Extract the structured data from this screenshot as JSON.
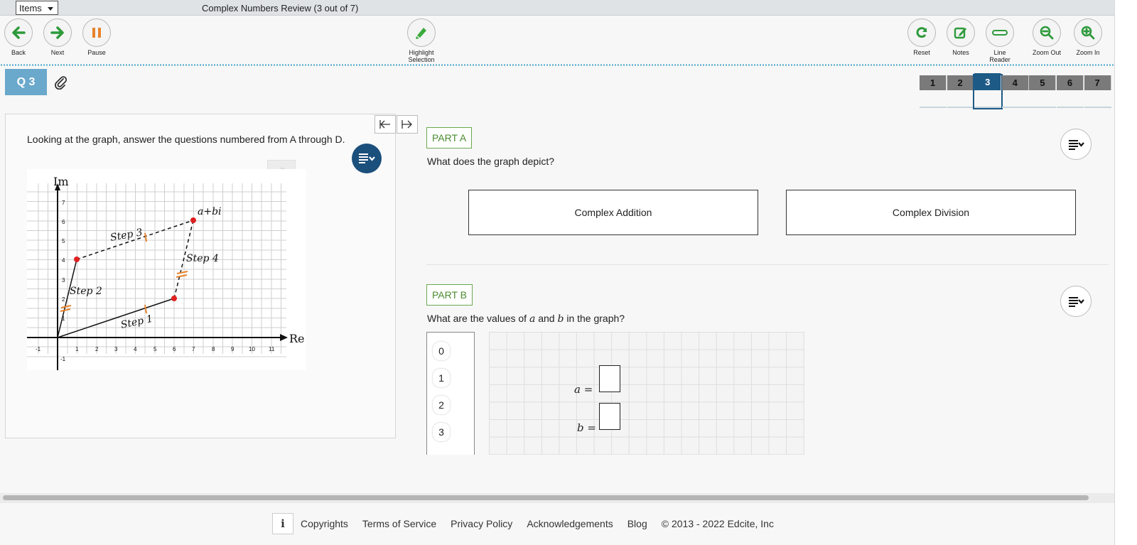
{
  "topbar": {
    "items_label": "Items",
    "title": "Complex Numbers Review (3 out of 7)"
  },
  "toolbar": {
    "back": "Back",
    "next": "Next",
    "pause": "Pause",
    "highlight": "Highlight Selection",
    "reset": "Reset",
    "notes": "Notes",
    "line_reader": "Line Reader",
    "zoom_out": "Zoom Out",
    "zoom_in": "Zoom In"
  },
  "question": {
    "badge": "Q 3",
    "nav": [
      "1",
      "2",
      "3",
      "4",
      "5",
      "6",
      "7"
    ],
    "current": "3"
  },
  "stimulus": {
    "prompt": "Looking at the graph, answer the questions numbered from A through D.",
    "tts_stub": "S",
    "graph": {
      "axis_x": "Re",
      "axis_y": "Im",
      "x_ticks": [
        "-1",
        "1",
        "2",
        "3",
        "4",
        "5",
        "6",
        "7",
        "8",
        "9",
        "10",
        "11"
      ],
      "y_ticks": [
        "-1",
        "1",
        "2",
        "3",
        "4",
        "5",
        "6",
        "7"
      ],
      "point_label": "a+bi",
      "steps": [
        "Step 1",
        "Step 2",
        "Step 3",
        "Step 4"
      ],
      "points": [
        [
          0,
          0
        ],
        [
          6,
          2
        ],
        [
          1,
          4
        ],
        [
          7,
          6
        ]
      ]
    }
  },
  "part_a": {
    "label": "PART A",
    "question": "What does the graph depict?",
    "options": [
      "Complex Addition",
      "Complex Division"
    ]
  },
  "part_b": {
    "label": "PART B",
    "question_pre": "What are the values of ",
    "var_a": "a",
    "question_mid": " and ",
    "var_b": "b",
    "question_post": " in the graph?",
    "tokens": [
      "0",
      "1",
      "2",
      "3"
    ],
    "eq_a": "a =",
    "eq_b": "b ="
  },
  "footer": {
    "info": "i",
    "links": [
      "Copyrights",
      "Terms of Service",
      "Privacy Policy",
      "Acknowledgements",
      "Blog"
    ],
    "copyright": "© 2013 - 2022 Edcite, Inc"
  },
  "colors": {
    "accent": "#1e5a86",
    "green": "#4b8b2f",
    "orange": "#e8822a",
    "point": "#e02020"
  }
}
